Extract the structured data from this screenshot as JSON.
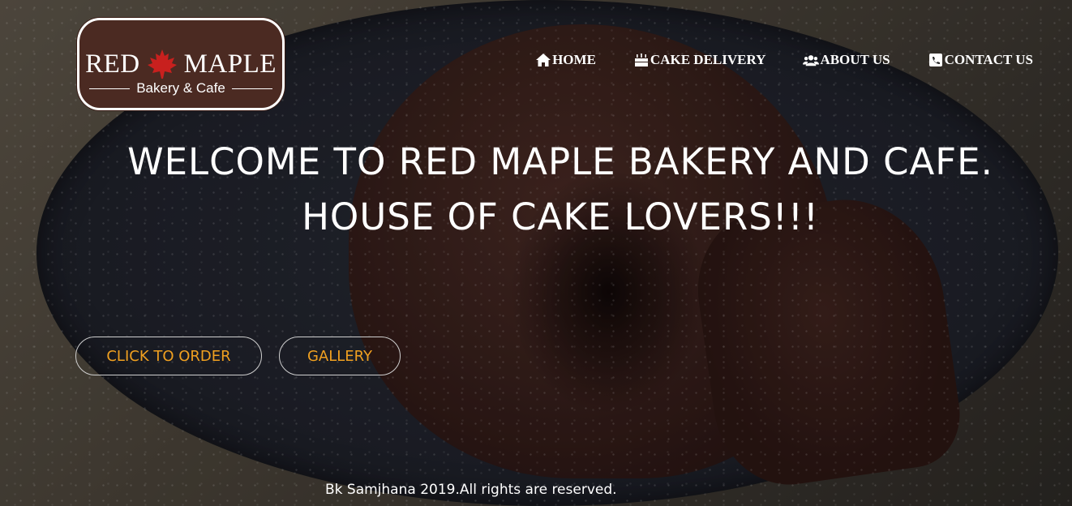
{
  "logo": {
    "brand_left": "RED",
    "brand_right": "MAPLE",
    "tagline": "Bakery & Cafe"
  },
  "nav": {
    "items": [
      {
        "label": "HOME",
        "icon": "home-icon"
      },
      {
        "label": "CAKE DELIVERY",
        "icon": "birthday-cake-icon"
      },
      {
        "label": "ABOUT US",
        "icon": "users-icon"
      },
      {
        "label": "CONTACT US",
        "icon": "phone-square-icon"
      }
    ]
  },
  "hero": {
    "line1": "WELCOME TO RED MAPLE BAKERY AND CAFE.",
    "line2": "HOUSE OF CAKE LOVERS!!!",
    "order_button": "CLICK TO ORDER",
    "gallery_button": "GALLERY"
  },
  "footer": {
    "text": "Bk Samjhana 2019.All rights are reserved."
  },
  "colors": {
    "logo_background": "#4b2a22",
    "button_text": "#f0a020",
    "text": "#ffffff"
  }
}
